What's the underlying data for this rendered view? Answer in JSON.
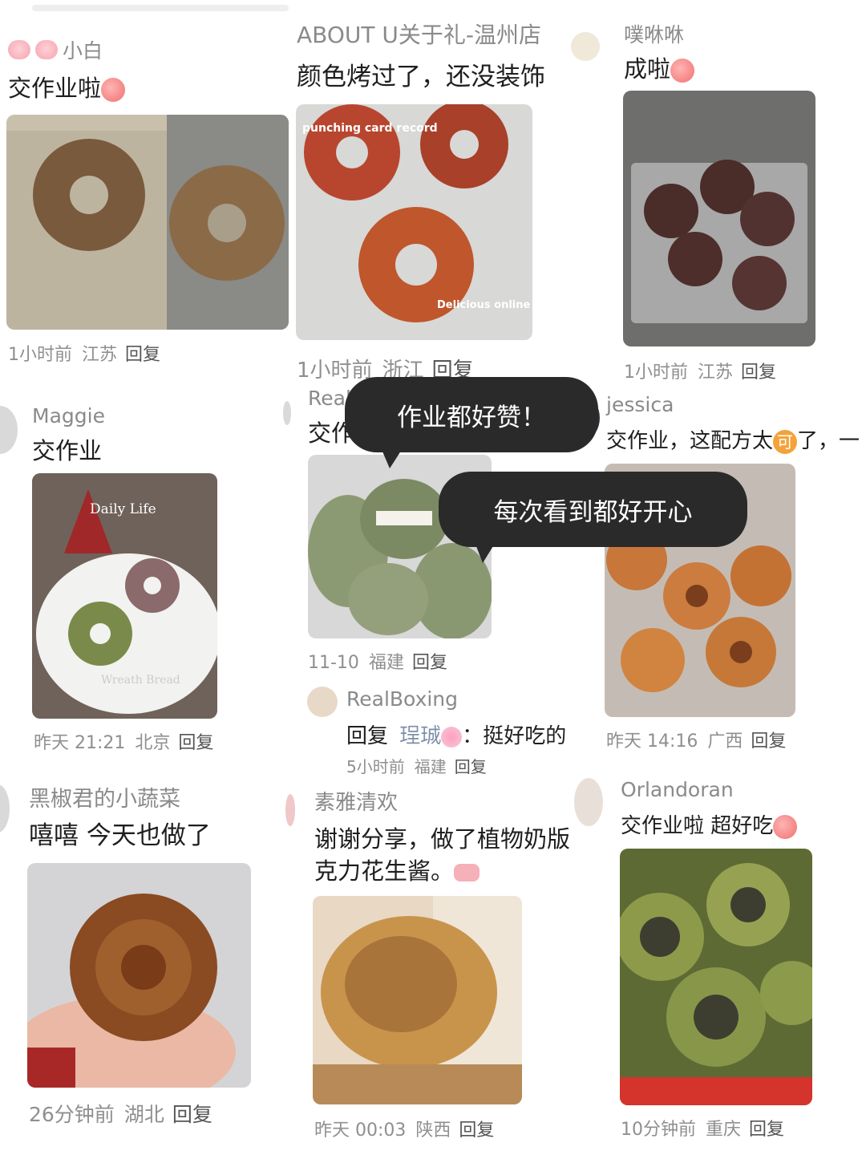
{
  "comments": [
    {
      "name": "小白",
      "text": "交作业啦",
      "time": "1小时前",
      "location": "江苏",
      "reply": "回复"
    },
    {
      "name": "ABOUT U关于礼-温州店",
      "text": "颜色烤过了，还没装饰",
      "time": "1小时前",
      "location": "浙江",
      "reply": "回复",
      "photo_caption_top": "punching card record",
      "photo_caption_bottom": "Delicious online"
    },
    {
      "name": "噗咻咻",
      "text": "成啦",
      "time": "1小时前",
      "location": "江苏",
      "reply": "回复"
    },
    {
      "name": "Maggie",
      "text": "交作业",
      "time": "昨天 21:21",
      "location": "北京",
      "reply": "回复",
      "photo_caption_top": "Daily Life",
      "photo_caption_bottom": "Wreath Bread"
    },
    {
      "name": "RealBoxing",
      "text": "交作业",
      "time": "11-10",
      "location": "福建",
      "reply": "回复"
    },
    {
      "name": "jessica",
      "text": "交作业，这配方太",
      "text_tail": "了，一",
      "emoji_char": "可",
      "time": "昨天 14:16",
      "location": "广西",
      "reply": "回复"
    },
    {
      "name": "黑椒君的小蔬菜",
      "text": "嘻嘻 今天也做了",
      "time": "26分钟前",
      "location": "湖北",
      "reply": "回复"
    },
    {
      "name": "素雅清欢",
      "text_line1": "谢谢分享，做了植物奶版",
      "text_line2": "克力花生酱。",
      "time": "昨天 00:03",
      "location": "陕西",
      "reply": "回复"
    },
    {
      "name": "Orlandoran",
      "text": "交作业啦 超好吃",
      "time": "10分钟前",
      "location": "重庆",
      "reply": "回复"
    }
  ],
  "sub_reply": {
    "name": "RealBoxing",
    "prefix": "回复",
    "target": "珵珹",
    "text": "：挺好吃的",
    "time": "5小时前",
    "location": "福建",
    "reply": "回复"
  },
  "bubbles": [
    "作业都好赞！",
    "每次看到都好开心"
  ],
  "colors": {
    "bubble_bg": "#2a2a2a",
    "meta_text": "#8f8f8f",
    "name_text": "#8a8a8a"
  }
}
